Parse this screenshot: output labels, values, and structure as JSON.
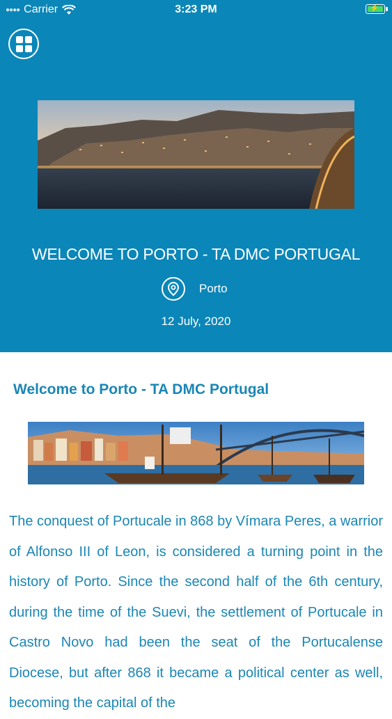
{
  "status_bar": {
    "carrier": "Carrier",
    "time": "3:23 PM",
    "icons": [
      "signal-dots-icon",
      "wifi-icon",
      "battery-charging-icon"
    ]
  },
  "header": {
    "menu_icon": "grid-icon",
    "title": "WELCOME TO PORTO - TA DMC PORTUGAL",
    "location": "Porto",
    "location_icon": "location-pin-icon",
    "date": "12 July, 2020",
    "background_color": "#0b86b8"
  },
  "content": {
    "title": "Welcome to Porto - TA DMC Portugal",
    "body": "The conquest of Portucale in 868 by Vímara Peres, a warrior of Alfonso III of Leon, is considered a turning point in the history of Porto. Since the second half of the 6th century, during the time of the Suevi, the settlement of Portucale in Castro Novo had been the seat of the Portucalense Diocese, but after 868 it became a political center as well, becoming the capital of the",
    "text_color": "#1a86b5"
  }
}
